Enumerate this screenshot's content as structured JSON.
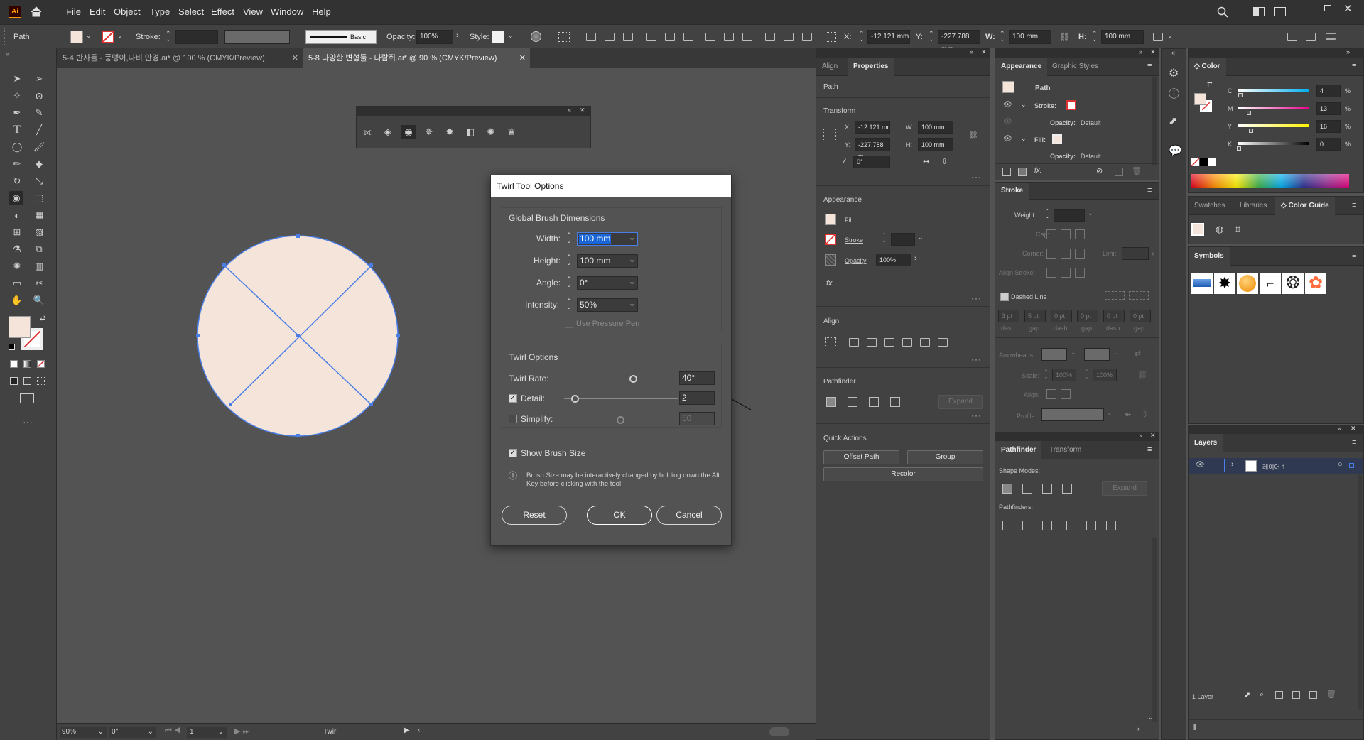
{
  "app": {
    "logo": "Ai",
    "menus": [
      "File",
      "Edit",
      "Object",
      "Type",
      "Select",
      "Effect",
      "View",
      "Window",
      "Help"
    ]
  },
  "control_bar": {
    "object_type": "Path",
    "stroke_label": "Stroke:",
    "stroke_value": "",
    "brush_label": "Basic",
    "opacity_label": "Opacity:",
    "opacity_value": "100%",
    "style_label": "Style:",
    "x_label": "X:",
    "x_value": "-12.121 mm",
    "y_label": "Y:",
    "y_value": "-227.788 mm",
    "w_label": "W:",
    "w_value": "100 mm",
    "h_label": "H:",
    "h_value": "100 mm"
  },
  "doc_tabs": [
    {
      "label": "5-4 반사툴 - 풍뎅이,나비,안경.ai* @ 100 % (CMYK/Preview)",
      "active": false
    },
    {
      "label": "5-8 다양한 변형툴 - 다람쥐.ai* @ 90 % (CMYK/Preview)",
      "active": true
    }
  ],
  "status": {
    "zoom": "90%",
    "rotate": "0°",
    "artboard": "1",
    "tool": "Twirl"
  },
  "twirl_dialog": {
    "title": "Twirl Tool Options",
    "global_section": "Global Brush Dimensions",
    "width_label": "Width:",
    "width_value": "100 mm",
    "height_label": "Height:",
    "height_value": "100 mm",
    "angle_label": "Angle:",
    "angle_value": "0°",
    "intensity_label": "Intensity:",
    "intensity_value": "50%",
    "pressure_label": "Use Pressure Pen",
    "twirl_section": "Twirl Options",
    "rate_label": "Twirl Rate:",
    "rate_value": "40°",
    "rate_level": 0.61,
    "detail_label": "Detail:",
    "detail_value": "2",
    "detail_level": 0.1,
    "simplify_label": "Simplify:",
    "simplify_value": "50",
    "simplify_level": 0.5,
    "show_brush_label": "Show Brush Size",
    "note": "Brush Size may be interactively changed by holding down the Alt Key before clicking with the tool.",
    "reset": "Reset",
    "ok": "OK",
    "cancel": "Cancel"
  },
  "properties_panel": {
    "tabs": [
      "Align",
      "Properties"
    ],
    "object_type": "Path",
    "transform_title": "Transform",
    "x_label": "X:",
    "x_value": "-12.121 mr",
    "y_label": "Y:",
    "y_value": "-227.788 m",
    "w_label": "W:",
    "w_value": "100 mm",
    "h_label": "H:",
    "h_value": "100 mm",
    "angle_value": "0°",
    "appearance_title": "Appearance",
    "fill_label": "Fill",
    "stroke_label": "Stroke",
    "opacity_label": "Opacity",
    "opacity_value": "100%",
    "fx_label": "fx.",
    "align_title": "Align",
    "pathfinder_title": "Pathfinder",
    "expand_label": "Expand",
    "quick_actions_title": "Quick Actions",
    "offset_path": "Offset Path",
    "group": "Group",
    "recolor": "Recolor"
  },
  "appearance_panel": {
    "tabs": [
      "Appearance",
      "Graphic Styles"
    ],
    "title": "Path",
    "stroke_label": "Stroke:",
    "opacity_label": "Opacity:",
    "opacity_value": "Default",
    "fill_label": "Fill:",
    "opacity2_label": "Opacity:",
    "opacity2_value": "Default"
  },
  "stroke_panel": {
    "title": "Stroke",
    "weight_label": "Weight:",
    "cap_label": "Cap:",
    "corner_label": "Corner:",
    "limit_label": "Limit:",
    "limit_unit": "x",
    "align_label": "Align Stroke:",
    "dashed_label": "Dashed Line",
    "dash_values": [
      "3 pt",
      "5 pt",
      "0 pt",
      "0 pt",
      "0 pt",
      "0 pt"
    ],
    "dash_labels": [
      "dash",
      "gap",
      "dash",
      "gap",
      "dash",
      "gap"
    ],
    "arrowheads_label": "Arrowheads:",
    "scale_label": "Scale:",
    "scale_value1": "100%",
    "scale_value2": "100%",
    "align2_label": "Align:",
    "profile_label": "Profile:"
  },
  "pathfinder_panel": {
    "tabs": [
      "Pathfinder",
      "Transform"
    ],
    "shape_modes": "Shape Modes:",
    "expand": "Expand",
    "pathfinders": "Pathfinders:"
  },
  "color_panel": {
    "title": "Color",
    "c_label": "C",
    "c_value": "4",
    "m_label": "M",
    "m_value": "13",
    "y_label": "Y",
    "y_value": "16",
    "k_label": "K",
    "k_value": "0",
    "percent": "%",
    "tabs": [
      "Swatches",
      "Libraries",
      "Color Guide"
    ],
    "fill_color": "#f5e4da"
  },
  "symbols_panel": {
    "title": "Symbols"
  },
  "layers_panel": {
    "title": "Layers",
    "layer_name": "레이어 1",
    "count": "1 Layer"
  },
  "colors": {
    "accent": "#4a7ee6",
    "fill": "#f5e4da",
    "selection": "#3e5bf0"
  }
}
